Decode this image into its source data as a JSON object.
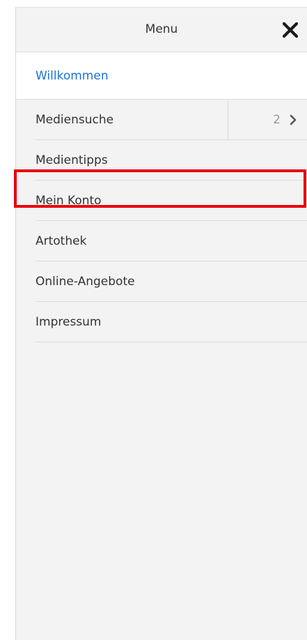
{
  "header": {
    "title": "Menu",
    "close_icon": "close-icon"
  },
  "menu": {
    "items": [
      {
        "label": "Willkommen",
        "active": true
      },
      {
        "label": "Mediensuche",
        "sub_count": "2",
        "sub_icon": "chevron-right-icon"
      },
      {
        "label": "Medientipps"
      },
      {
        "label": "Mein Konto",
        "highlighted": true
      },
      {
        "label": "Artothek"
      },
      {
        "label": "Online-Angebote"
      },
      {
        "label": "Impressum"
      }
    ]
  },
  "colors": {
    "active_text": "#1a73d9",
    "highlight_border": "#e8000b",
    "panel_bg": "#f3f3f3"
  }
}
